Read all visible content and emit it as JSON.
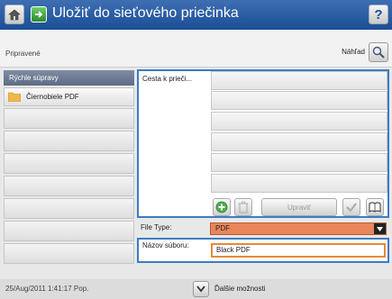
{
  "header": {
    "title": "Uložiť do sieťového priečinka",
    "home_icon": "home-icon",
    "app_icon": "folder-arrow-icon",
    "help_symbol": "?"
  },
  "status": {
    "text": "Pripravené",
    "preview_label": "Náhľad",
    "preview_icon": "magnifier-icon"
  },
  "quick_sets": {
    "header": "Rýchle súpravy",
    "items": [
      {
        "label": "Čiernobiele PDF",
        "icon": "folder-icon"
      }
    ]
  },
  "folder_path": {
    "label": "Cesta k prieči..."
  },
  "toolbar": {
    "add_icon": "add-icon",
    "delete_icon": "trash-icon",
    "edit_label": "Upraviť",
    "check_icon": "check-icon",
    "book_icon": "address-book-icon"
  },
  "file_type": {
    "label": "File Type:",
    "value": "PDF"
  },
  "file_name": {
    "label": "Názov súboru:",
    "value": "Black PDF"
  },
  "footer": {
    "timestamp": "25/Aug/2011 1:41:17 Pop.",
    "more_label": "Ďalšie možnosti"
  },
  "colors": {
    "titlebar": "#1b4e96",
    "select_orange": "#e9865a",
    "focus_blue": "#3d7cc4"
  }
}
